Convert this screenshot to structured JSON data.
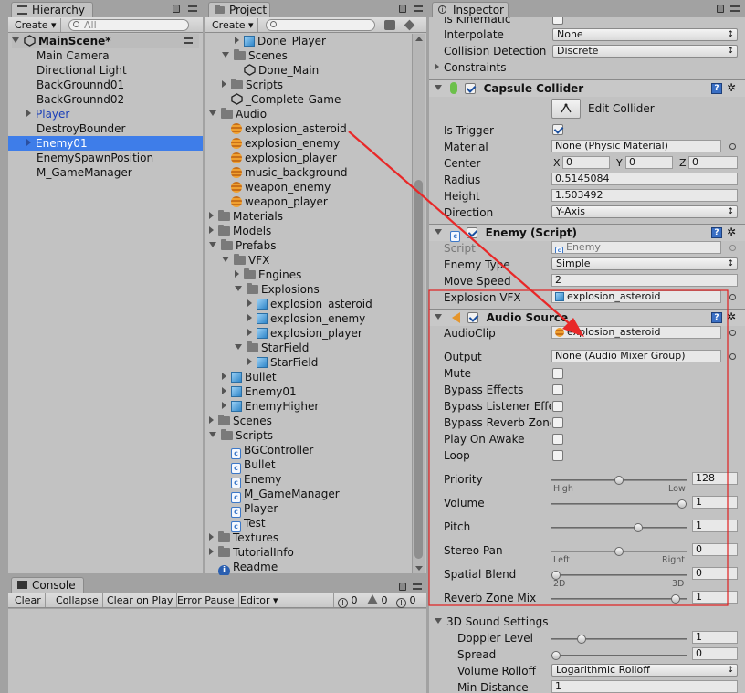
{
  "hierarchy": {
    "tab": "Hierarchy",
    "create": "Create ▾",
    "search_placeholder": "All",
    "scene": "MainScene*",
    "items": [
      "Main Camera",
      "Directional Light",
      "BackGrounnd01",
      "BackGrounnd02",
      "Player",
      "DestroyBounder",
      "Enemy01",
      "EnemySpawnPosition",
      "M_GameManager"
    ]
  },
  "project": {
    "tab": "Project",
    "create": "Create ▾",
    "items": [
      "Done_Player",
      "Scenes",
      "Done_Main",
      "Scripts",
      "_Complete-Game",
      "Audio",
      "explosion_asteroid",
      "explosion_enemy",
      "explosion_player",
      "music_background",
      "weapon_enemy",
      "weapon_player",
      "Materials",
      "Models",
      "Prefabs",
      "VFX",
      "Engines",
      "Explosions",
      "explosion_asteroid",
      "explosion_enemy",
      "explosion_player",
      "StarField",
      "StarField",
      "Bullet",
      "Enemy01",
      "EnemyHigher",
      "Scenes",
      "Scripts",
      "BGController",
      "Bullet",
      "Enemy",
      "M_GameManager",
      "Player",
      "Test",
      "Textures",
      "TutorialInfo",
      "Readme"
    ]
  },
  "console": {
    "tab": "Console",
    "buttons": [
      "Clear",
      "Collapse",
      "Clear on Play",
      "Error Pause",
      "Editor ▾"
    ],
    "counts": [
      "0",
      "0",
      "0"
    ]
  },
  "inspector": {
    "tab": "Inspector",
    "top": {
      "is_kinematic": "Is Kinematic",
      "interpolate": "Interpolate",
      "interpolate_val": "None",
      "collision": "Collision Detection",
      "collision_val": "Discrete",
      "constraints": "Constraints"
    },
    "capsule": {
      "title": "Capsule Collider",
      "edit": "Edit Collider",
      "is_trigger": "Is Trigger",
      "material": "Material",
      "material_val": "None (Physic Material)",
      "center": "Center",
      "cx": "0",
      "cy": "0",
      "cz": "0",
      "x": "X",
      "y": "Y",
      "z": "Z",
      "radius": "Radius",
      "radius_val": "0.5145084",
      "height": "Height",
      "height_val": "1.503492",
      "direction": "Direction",
      "direction_val": "Y-Axis"
    },
    "enemy": {
      "title": "Enemy (Script)",
      "script": "Script",
      "script_val": "Enemy",
      "enemy_type": "Enemy Type",
      "enemy_type_val": "Simple",
      "move_speed": "Move Speed",
      "move_speed_val": "2",
      "vfx": "Explosion VFX",
      "vfx_val": "explosion_asteroid"
    },
    "audio": {
      "title": "Audio Source",
      "clip": "AudioClip",
      "clip_val": "explosion_asteroid",
      "output": "Output",
      "output_val": "None (Audio Mixer Group)",
      "mute": "Mute",
      "bypass_effects": "Bypass Effects",
      "bypass_listener": "Bypass Listener Effe",
      "bypass_reverb": "Bypass Reverb Zone",
      "play_on_awake": "Play On Awake",
      "loop": "Loop",
      "priority": "Priority",
      "priority_val": "128",
      "high": "High",
      "low": "Low",
      "volume": "Volume",
      "volume_val": "1",
      "pitch": "Pitch",
      "pitch_val": "1",
      "stereo": "Stereo Pan",
      "stereo_val": "0",
      "left": "Left",
      "right": "Right",
      "spatial": "Spatial Blend",
      "spatial_val": "0",
      "d2": "2D",
      "d3": "3D",
      "reverb": "Reverb Zone Mix",
      "reverb_val": "1"
    },
    "sound3d": {
      "title": "3D Sound Settings",
      "doppler": "Doppler Level",
      "doppler_val": "1",
      "spread": "Spread",
      "spread_val": "0",
      "rolloff": "Volume Rolloff",
      "rolloff_val": "Logarithmic Rolloff",
      "min": "Min Distance",
      "min_val": "1"
    },
    "levels": {
      "priority": 0.5,
      "volume": 1,
      "pitch": 0.65,
      "stereo": 0.5,
      "spatial": 0,
      "reverb": 0.95,
      "doppler": 0.2,
      "spread": 0
    }
  }
}
